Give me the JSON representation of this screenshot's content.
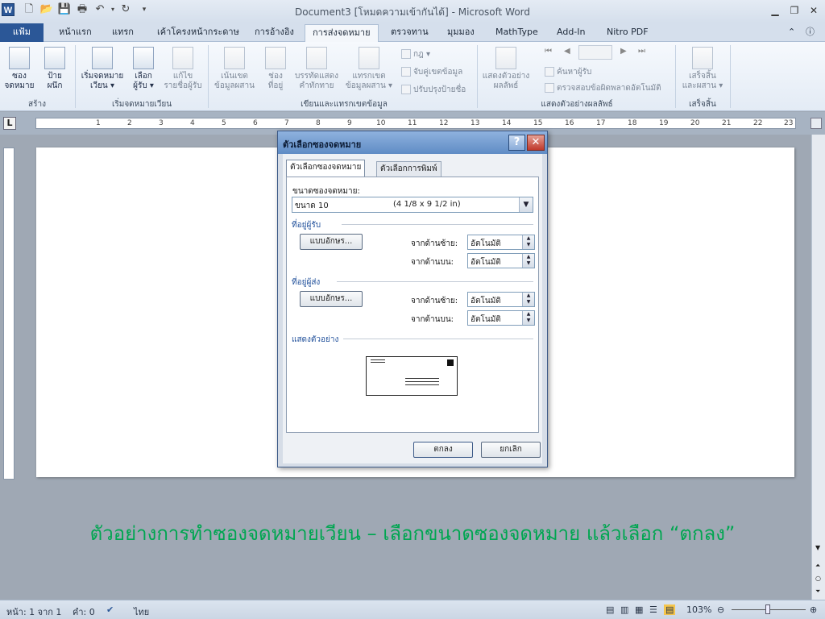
{
  "window": {
    "title": "Document3 [โหมดความเข้ากันได้] - Microsoft Word",
    "app_icon": "W",
    "qat_icons": [
      "new-doc-icon",
      "open-folder-icon",
      "save-icon",
      "print-icon",
      "undo-icon",
      "redo-icon",
      "customize-qat-icon"
    ],
    "controls": [
      "minimize-icon",
      "restore-icon",
      "close-icon"
    ]
  },
  "tabs": {
    "file": "แฟ้ม",
    "items": [
      "หน้าแรก",
      "แทรก",
      "เค้าโครงหน้ากระดาษ",
      "การอ้างอิง",
      "การส่งจดหมาย",
      "ตรวจทาน",
      "มุมมอง",
      "MathType",
      "Add-In",
      "Nitro PDF"
    ],
    "active": "การส่งจดหมาย"
  },
  "ribbon": {
    "create": {
      "label": "สร้าง",
      "envelopes": [
        "ซอง",
        "จดหมาย"
      ],
      "labels": [
        "ป้าย",
        "ผนึก"
      ]
    },
    "start_mail_merge": {
      "label": "เริ่มจดหมายเวียน",
      "start": [
        "เริ่มจดหมาย",
        "เวียน ▾"
      ],
      "select_recipients": [
        "เลือก",
        "ผู้รับ ▾"
      ],
      "edit_recipients": [
        "แก้ไข",
        "รายชื่อผู้รับ"
      ]
    },
    "write_insert": {
      "label": "เขียนและแทรกเขตข้อมูล",
      "highlight": [
        "เน้นเขต",
        "ข้อมูลผสาน"
      ],
      "address_block": [
        "ช่อง",
        "ที่อยู่"
      ],
      "greeting": [
        "บรรทัดแสดง",
        "คำทักทาย"
      ],
      "insert_field": [
        "แทรกเขต",
        "ข้อมูลผสาน ▾"
      ],
      "rules": "กฎ ▾",
      "match_fields": "จับคู่เขตข้อมูล",
      "update_labels": "ปรับปรุงป้ายชื่อ"
    },
    "preview": {
      "label": "แสดงตัวอย่างผลลัพธ์",
      "preview_results": [
        "แสดงตัวอย่าง",
        "ผลลัพธ์"
      ],
      "find_recipient": "ค้นหาผู้รับ",
      "auto_check": "ตรวจสอบข้อผิดพลาดอัตโนมัติ"
    },
    "finish": {
      "label": "เสร็จสิ้น",
      "finish_merge": [
        "เสร็จสิ้น",
        "และผสาน ▾"
      ]
    }
  },
  "ruler": {
    "corner": "L",
    "ticks": [
      "1",
      "2",
      "3",
      "4",
      "5",
      "6",
      "7",
      "8",
      "9",
      "10",
      "11",
      "12",
      "13",
      "14",
      "15",
      "16",
      "17",
      "18",
      "19",
      "20",
      "21",
      "22",
      "23"
    ]
  },
  "dialog": {
    "title": "ตัวเลือกซองจดหมาย",
    "help": "?",
    "close": "✕",
    "tabs": [
      "ตัวเลือกซองจดหมาย",
      "ตัวเลือกการพิมพ์"
    ],
    "size_label": "ขนาดซองจดหมาย:",
    "size_name": "ขนาด 10",
    "size_dim": "(4 1/8 x 9 1/2 in)",
    "delivery": {
      "heading": "ที่อยู่ผู้รับ",
      "font_button": "แบบอักษร...",
      "from_left_label": "จากด้านซ้าย:",
      "from_left_value": "อัตโนมัติ",
      "from_top_label": "จากด้านบน:",
      "from_top_value": "อัตโนมัติ"
    },
    "return": {
      "heading": "ที่อยู่ผู้ส่ง",
      "font_button": "แบบอักษร...",
      "from_left_label": "จากด้านซ้าย:",
      "from_left_value": "อัตโนมัติ",
      "from_top_label": "จากด้านบน:",
      "from_top_value": "อัตโนมัติ"
    },
    "preview_heading": "แสดงตัวอย่าง",
    "ok": "ตกลง",
    "cancel": "ยกเลิก"
  },
  "caption": "ตัวอย่างการทำซองจดหมายเวียน – เลือกขนาดซองจดหมาย แล้วเลือก “ตกลง”",
  "status": {
    "page": "หน้า: 1 จาก 1",
    "words": "คำ: 0",
    "language": "ไทย",
    "zoom": "103%"
  },
  "colors": {
    "caption": "#00a651",
    "file_tab": "#2b5797"
  }
}
